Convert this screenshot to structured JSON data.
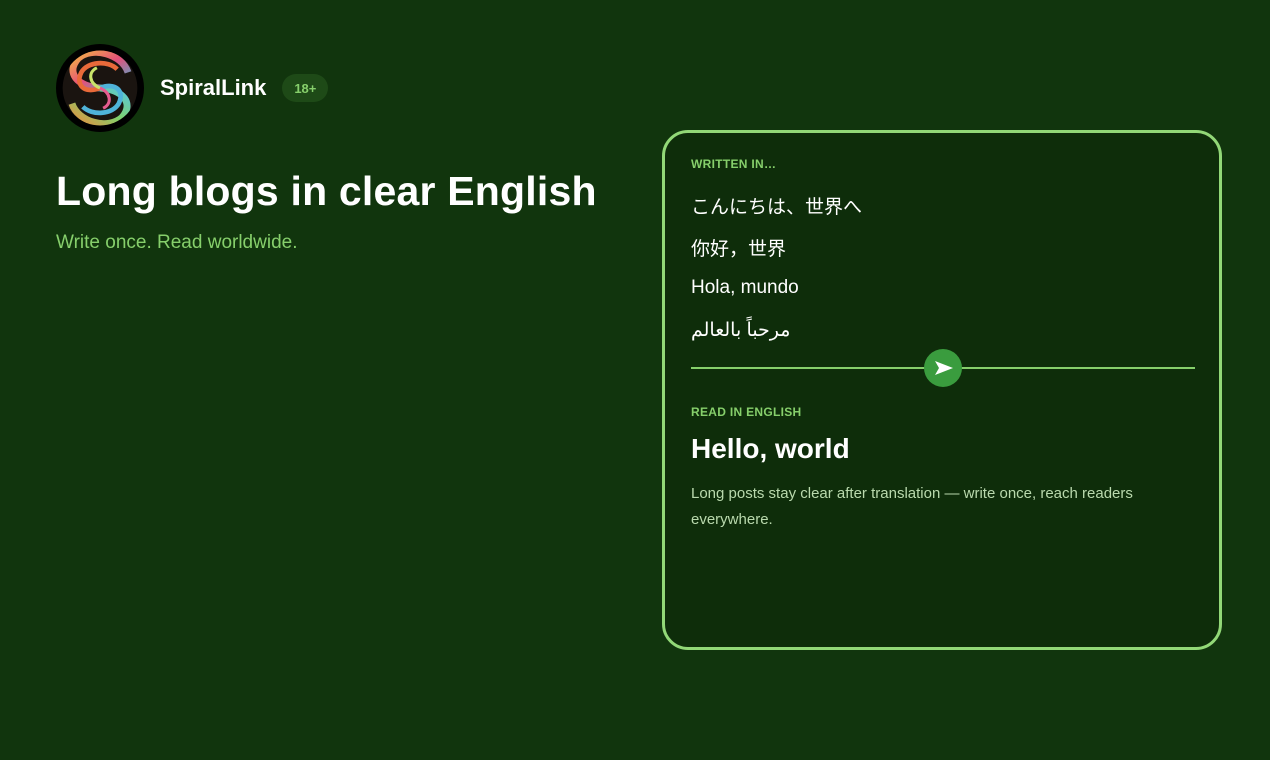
{
  "brand": {
    "name": "SpiralLink",
    "age_badge": "18+",
    "logo_icon": "spiral-logo-icon"
  },
  "hero": {
    "title": "Long blogs in clear English",
    "subtitle": "Write once. Read worldwide."
  },
  "card": {
    "written_label": "WRITTEN IN…",
    "lines": [
      "こんにちは、世界へ",
      "你好，世界",
      "Hola, mundo",
      "مرحباً بالعالم"
    ],
    "slider_icon": "play-arrow-icon",
    "read_label": "READ IN ENGLISH",
    "result_title": "Hello, world",
    "result_description": "Long posts stay clear after translation — write once, reach readers everywhere."
  },
  "colors": {
    "background": "#11350d",
    "card_background": "#0e2d0a",
    "accent": "#86cf6b",
    "card_border": "#92d877",
    "slider_thumb": "#3a9c3e"
  }
}
